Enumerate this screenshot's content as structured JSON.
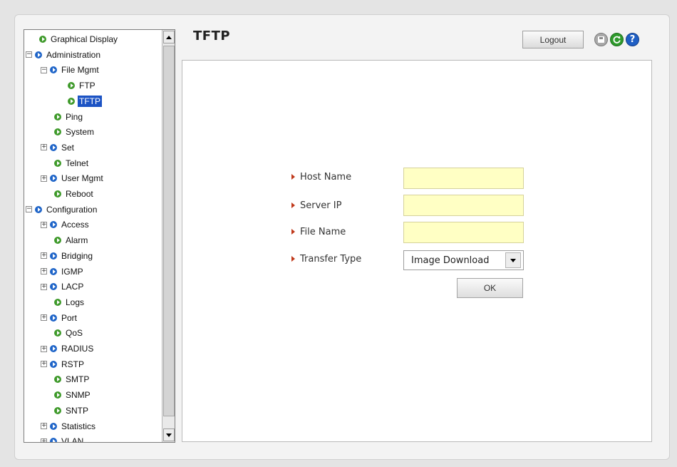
{
  "page": {
    "title": "TFTP"
  },
  "header": {
    "logout_label": "Logout",
    "icons": [
      "save-icon",
      "refresh-icon",
      "help-icon"
    ],
    "help_glyph": "?"
  },
  "colors": {
    "accent": "#1c53c4",
    "input_bg": "#ffffc4",
    "label_arrow": "#c0391b",
    "node_green": "#3f9a2b",
    "node_blue": "#1e64c8"
  },
  "nav": {
    "items": [
      {
        "label": "Graphical Display",
        "expander": "",
        "bullet": "green"
      },
      {
        "label": "Administration",
        "expander": "−",
        "bullet": "blue"
      },
      {
        "label": "File Mgmt",
        "expander": "−",
        "bullet": "blue"
      },
      {
        "label": "FTP",
        "expander": "",
        "bullet": "green"
      },
      {
        "label": "TFTP",
        "expander": "",
        "bullet": "green",
        "selected": true
      },
      {
        "label": "Ping",
        "expander": "",
        "bullet": "green"
      },
      {
        "label": "System",
        "expander": "",
        "bullet": "green"
      },
      {
        "label": "Set",
        "expander": "+",
        "bullet": "blue"
      },
      {
        "label": "Telnet",
        "expander": "",
        "bullet": "green"
      },
      {
        "label": "User Mgmt",
        "expander": "+",
        "bullet": "blue"
      },
      {
        "label": "Reboot",
        "expander": "",
        "bullet": "green"
      },
      {
        "label": "Configuration",
        "expander": "−",
        "bullet": "blue"
      },
      {
        "label": "Access",
        "expander": "+",
        "bullet": "blue"
      },
      {
        "label": "Alarm",
        "expander": "",
        "bullet": "green"
      },
      {
        "label": "Bridging",
        "expander": "+",
        "bullet": "blue"
      },
      {
        "label": "IGMP",
        "expander": "+",
        "bullet": "blue"
      },
      {
        "label": "LACP",
        "expander": "+",
        "bullet": "blue"
      },
      {
        "label": "Logs",
        "expander": "",
        "bullet": "green"
      },
      {
        "label": "Port",
        "expander": "+",
        "bullet": "blue"
      },
      {
        "label": "QoS",
        "expander": "",
        "bullet": "green"
      },
      {
        "label": "RADIUS",
        "expander": "+",
        "bullet": "blue"
      },
      {
        "label": "RSTP",
        "expander": "+",
        "bullet": "blue"
      },
      {
        "label": "SMTP",
        "expander": "",
        "bullet": "green"
      },
      {
        "label": "SNMP",
        "expander": "",
        "bullet": "green"
      },
      {
        "label": "SNTP",
        "expander": "",
        "bullet": "green"
      },
      {
        "label": "Statistics",
        "expander": "+",
        "bullet": "blue"
      },
      {
        "label": "VLAN",
        "expander": "+",
        "bullet": "blue"
      }
    ]
  },
  "form": {
    "host_name": {
      "label": "Host Name",
      "value": ""
    },
    "server_ip": {
      "label": "Server IP",
      "value": ""
    },
    "file_name": {
      "label": "File Name",
      "value": ""
    },
    "transfer_type": {
      "label": "Transfer Type",
      "value": "Image Download"
    },
    "ok_label": "OK"
  }
}
